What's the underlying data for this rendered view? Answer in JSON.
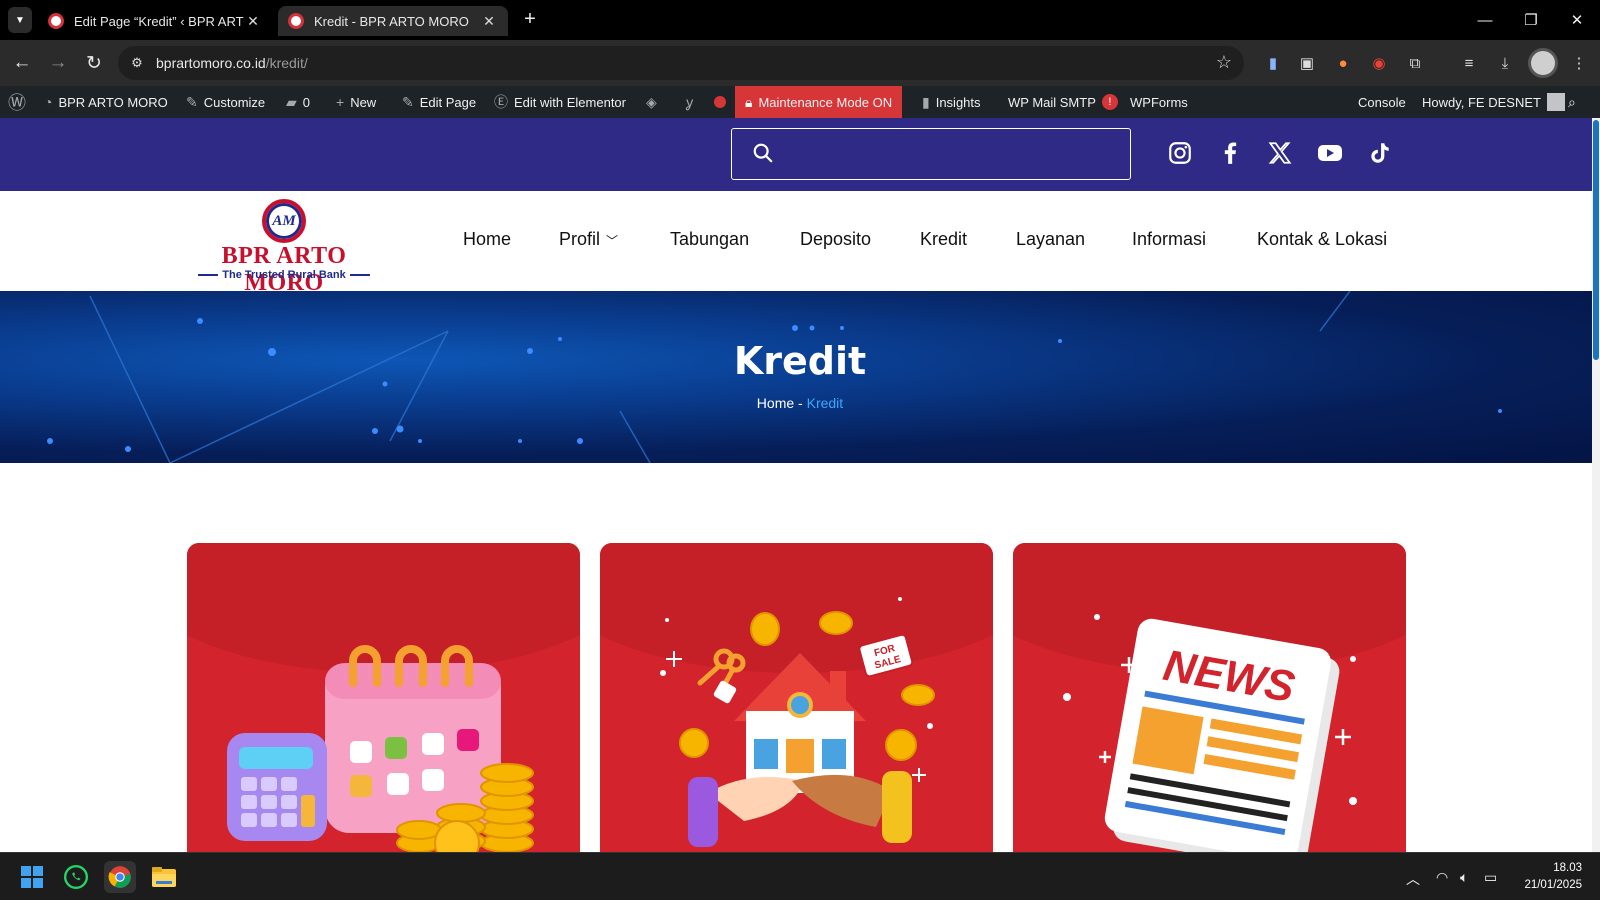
{
  "browser": {
    "tabs": [
      {
        "title": "Edit Page “Kredit” ‹ BPR ARTO MORO",
        "active": false
      },
      {
        "title": "Kredit - BPR ARTO MORO",
        "active": true
      }
    ],
    "url_host": "bprartomoro.co.id",
    "url_path": "/kredit/"
  },
  "wp_admin_bar": {
    "site_name": "BPR ARTO MORO",
    "customize": "Customize",
    "comments_count": "0",
    "new": "New",
    "edit_page": "Edit Page",
    "edit_elementor": "Edit with Elementor",
    "maintenance": "Maintenance Mode ON",
    "insights": "Insights",
    "wp_mail_smtp": "WP Mail SMTP",
    "smtp_badge": "!",
    "wpforms": "WPForms",
    "console": "Console",
    "howdy": "Howdy, FE DESNET"
  },
  "site": {
    "search_placeholder": "",
    "social": [
      "instagram-icon",
      "facebook-icon",
      "x-twitter-icon",
      "youtube-icon",
      "tiktok-icon"
    ],
    "logo_name": "BPR ARTO MORO",
    "logo_tagline": "The Trusted Rural Bank",
    "nav": [
      "Home",
      "Profil",
      "Tabungan",
      "Deposito",
      "Kredit",
      "Layanan",
      "Informasi",
      "Kontak & Lokasi"
    ],
    "hero_title": "Kredit",
    "breadcrumb": {
      "home": "Home",
      "sep": "-",
      "current": "Kredit"
    },
    "cards": [
      {
        "illustration": "calculator-calendar-coins",
        "text": ""
      },
      {
        "illustration": "house-handshake-for-sale",
        "text": "FOR SALE"
      },
      {
        "illustration": "newspaper",
        "text": "NEWS"
      }
    ]
  },
  "colors": {
    "top_bar": "#2e2a86",
    "card_red": "#d3232c",
    "breadcrumb_current": "#3aa7ff",
    "maintenance_red": "#d63638"
  },
  "taskbar": {
    "time": "18.03",
    "date": "21/01/2025"
  }
}
